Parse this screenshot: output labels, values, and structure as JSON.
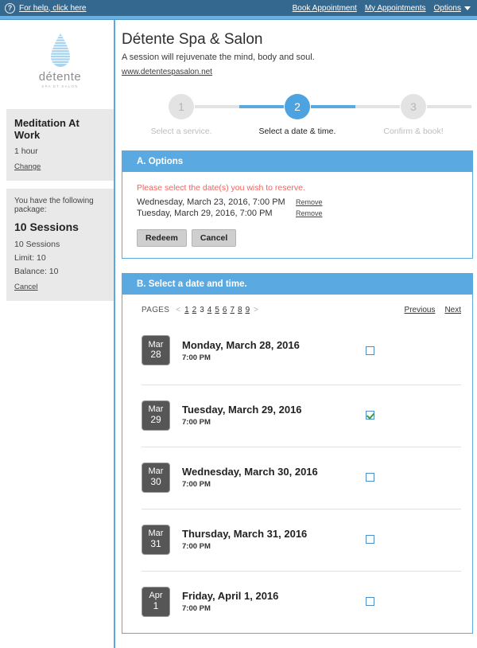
{
  "topbar": {
    "help_icon": "question-mark-icon",
    "help_link": "For help, click here",
    "links": [
      "Book Appointment",
      "My Appointments",
      "Options"
    ],
    "options_caret": "chevron-down-icon"
  },
  "sidebar": {
    "logo": {
      "word": "détente",
      "sub": "SPA ET SALON",
      "icon": "water-drop-icon"
    },
    "service_panel": {
      "title": "Meditation At Work",
      "duration": "1 hour",
      "change_link": "Change"
    },
    "package_panel": {
      "lead": "You have the following package:",
      "name": "10 Sessions",
      "sessions": "10 Sessions",
      "limit": "Limit: 10",
      "balance": "Balance: 10",
      "cancel_link": "Cancel"
    }
  },
  "brand": {
    "title": "Détente Spa & Salon",
    "tagline": "A session will rejuvenate the mind, body and soul.",
    "url": "www.detentespasalon.net"
  },
  "stepper": {
    "steps": [
      {
        "number": "1",
        "label": "Select a service.",
        "active": false
      },
      {
        "number": "2",
        "label": "Select a date & time.",
        "active": true
      },
      {
        "number": "3",
        "label": "Confirm & book!",
        "active": false
      }
    ]
  },
  "options_card": {
    "heading": "A. Options",
    "notice": "Please select the date(s) you wish to reserve.",
    "reservations": [
      {
        "date": "Wednesday, March 23, 2016, 7:00 PM",
        "remove": "Remove"
      },
      {
        "date": "Tuesday, March 29, 2016, 7:00 PM",
        "remove": "Remove"
      }
    ],
    "redeem_button": "Redeem",
    "cancel_button": "Cancel"
  },
  "datetime_card": {
    "heading": "B. Select a date and time.",
    "pages_label": "PAGES",
    "prev_arrow": "<",
    "next_arrow": ">",
    "pages": [
      {
        "n": "1",
        "current": false
      },
      {
        "n": "2",
        "current": false
      },
      {
        "n": "3",
        "current": true
      },
      {
        "n": "4",
        "current": false
      },
      {
        "n": "5",
        "current": false
      },
      {
        "n": "6",
        "current": false
      },
      {
        "n": "7",
        "current": false
      },
      {
        "n": "8",
        "current": false
      },
      {
        "n": "9",
        "current": false
      }
    ],
    "previous_link": "Previous",
    "next_link": "Next",
    "slots": [
      {
        "month": "Mar",
        "day": "28",
        "title": "Monday, March 28, 2016",
        "time": "7:00 PM",
        "checked": false
      },
      {
        "month": "Mar",
        "day": "29",
        "title": "Tuesday, March 29, 2016",
        "time": "7:00 PM",
        "checked": true
      },
      {
        "month": "Mar",
        "day": "30",
        "title": "Wednesday, March 30, 2016",
        "time": "7:00 PM",
        "checked": false
      },
      {
        "month": "Mar",
        "day": "31",
        "title": "Thursday, March 31, 2016",
        "time": "7:00 PM",
        "checked": false
      },
      {
        "month": "Apr",
        "day": "1",
        "title": "Friday, April 1, 2016",
        "time": "7:00 PM",
        "checked": false
      }
    ]
  },
  "colors": {
    "topbar": "#35688f",
    "accent": "#5aa9e0",
    "notice": "#f1645f",
    "badge": "#565656",
    "panel_bg": "#e9e9e9"
  }
}
